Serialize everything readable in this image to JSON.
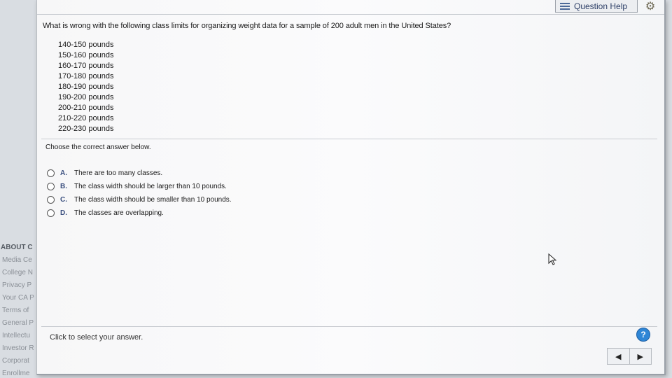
{
  "header": {
    "question_help_label": "Question Help",
    "icons": [
      "list-icon",
      "gear-icon"
    ]
  },
  "question": {
    "text": "What is wrong with the following class limits for organizing weight data for a sample of 200 adult men in the United States?",
    "class_limits": [
      "140-150 pounds",
      "150-160 pounds",
      "160-170 pounds",
      "170-180 pounds",
      "180-190 pounds",
      "190-200 pounds",
      "200-210 pounds",
      "210-220 pounds",
      "220-230 pounds"
    ],
    "instruction": "Choose the correct answer below.",
    "options": [
      {
        "letter": "A.",
        "text": "There are too many classes."
      },
      {
        "letter": "B.",
        "text": "The class width should be larger than 10 pounds."
      },
      {
        "letter": "C.",
        "text": "The class width should be smaller than 10 pounds."
      },
      {
        "letter": "D.",
        "text": "The classes are overlapping."
      }
    ]
  },
  "footer": {
    "status_text": "Click to select your answer.",
    "help_label": "?",
    "prev_label": "◀",
    "next_label": "▶"
  },
  "background_sidebar": {
    "heading": "ABOUT C",
    "links": [
      "Media Ce",
      "College N",
      "Privacy P",
      "Your CA P",
      "Terms of",
      "General P",
      "Intellectu",
      "Investor R",
      "Corporat",
      "Enrollme"
    ]
  },
  "colors": {
    "accent": "#2f86d6",
    "option_letter": "#3a4f7e"
  }
}
